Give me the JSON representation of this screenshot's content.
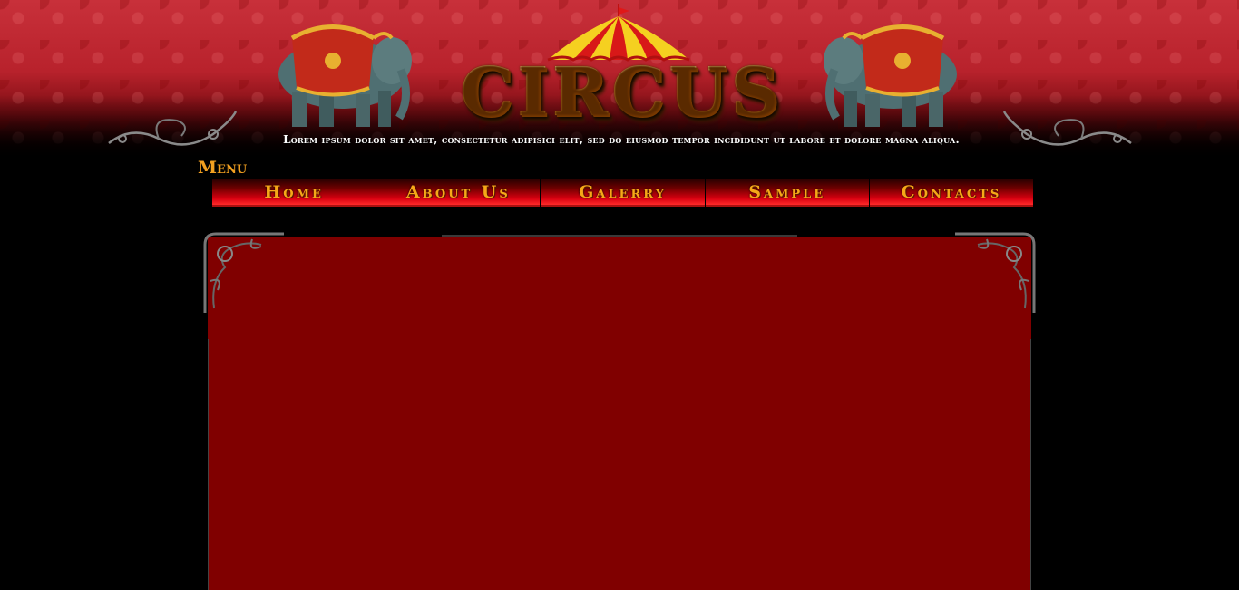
{
  "brand": {
    "logo_text": "CIRCUS",
    "tagline": "Lorem ipsum dolor sit amet, consectetur adipisici elit, sed do eiusmod tempor incididunt ut labore et dolore magna aliqua."
  },
  "menu": {
    "label": "Menu",
    "items": [
      {
        "label": "Home"
      },
      {
        "label": "About Us"
      },
      {
        "label": "Galerry"
      },
      {
        "label": "Sample"
      },
      {
        "label": "Contacts"
      }
    ]
  },
  "icons": {
    "left_elephant": "elephant-icon",
    "right_elephant": "elephant-icon",
    "tent": "circus-tent-icon",
    "flourish": "ornament-flourish",
    "corner": "ornament-corner"
  },
  "colors": {
    "header_red": "#c8303a",
    "nav_gold": "#f6a818",
    "panel_red": "#800000",
    "background": "#000000"
  }
}
